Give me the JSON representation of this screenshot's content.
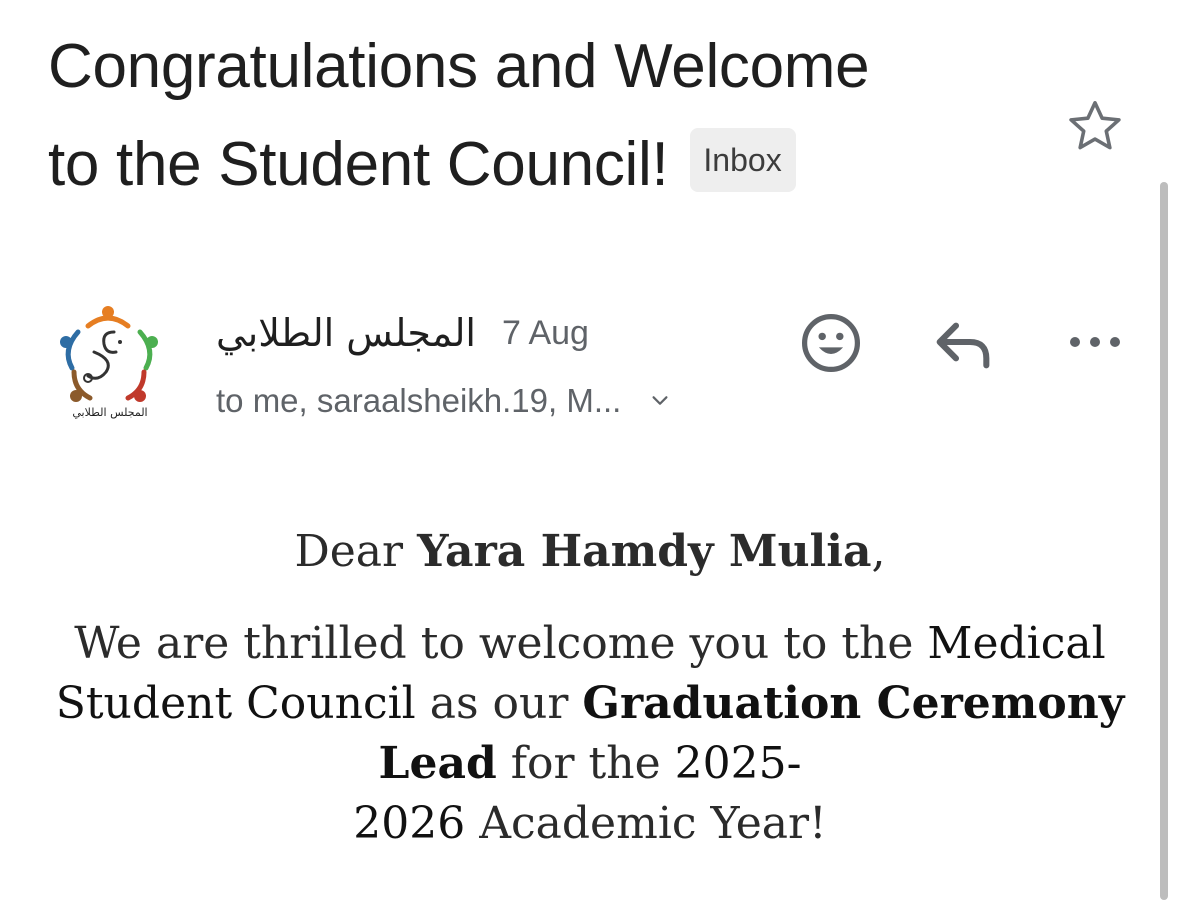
{
  "email": {
    "subject_line1": "Congratulations and Welcome",
    "subject_line2": "to the Student Council!",
    "label": "Inbox",
    "sender": {
      "name": "المجلس الطلابي",
      "avatar_caption": "المجلس الطلابي",
      "date": "7 Aug"
    },
    "recipients": "to me, saraalsheikh.19, M...",
    "actions": {
      "star": "star-outline-icon",
      "emoji": "emoji-reaction-icon",
      "reply": "reply-arrow-icon",
      "more": "more-horizontal-icon",
      "expand_recipients": "chevron-down-icon"
    }
  },
  "message": {
    "greeting_prefix": "Dear ",
    "recipient_name": "Yara Hamdy Mulia",
    "greeting_suffix": ",",
    "p1_a": "We are thrilled to welcome you to the ",
    "p1_org": "Medical Student Council",
    "p1_b": " as our ",
    "p1_role": "Graduation Ceremony Lead",
    "p1_c": " for the ",
    "p1_year_start": "2025-",
    "p1_year_end": "2026",
    "p1_d": " Academic Year!"
  },
  "colors": {
    "text_primary": "#1f1f1f",
    "text_secondary": "#5f6368",
    "label_bg": "#eeeeee",
    "logo_orange": "#e67e22",
    "logo_green": "#4caf50",
    "logo_blue": "#2e6da4",
    "logo_red": "#c0392b",
    "logo_brown": "#8b5a2b"
  }
}
